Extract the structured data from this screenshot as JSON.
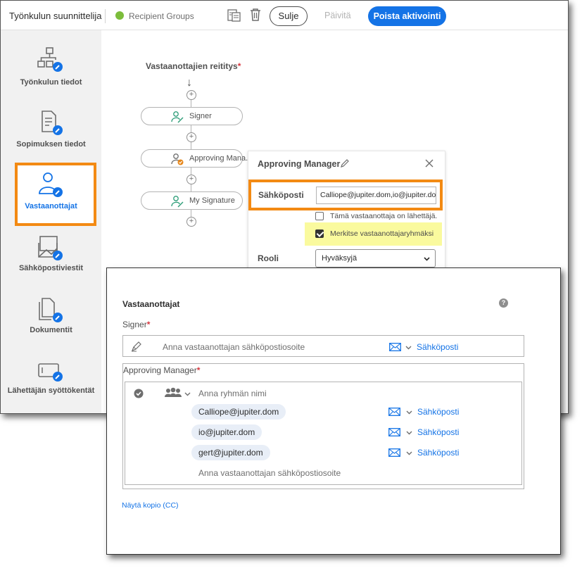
{
  "header": {
    "app_title": "Työnkulun suunnittelija",
    "group_name": "Recipient Groups",
    "status_color": "#7cbd3b",
    "close_label": "Sulje",
    "update_label": "Päivitä",
    "deactivate_label": "Poista aktivointi",
    "accent_color": "#1473e6"
  },
  "sidebar": {
    "items": [
      {
        "label": "Työnkulun tiedot",
        "icon": "workflow-info-icon"
      },
      {
        "label": "Sopimuksen tiedot",
        "icon": "agreement-info-icon"
      },
      {
        "label": "Vastaanottajat",
        "icon": "recipients-icon",
        "active": true
      },
      {
        "label": "Sähköpostiviestit",
        "icon": "email-messages-icon"
      },
      {
        "label": "Dokumentit",
        "icon": "documents-icon"
      },
      {
        "label": "Lähettäjän syöttökentät",
        "icon": "sender-input-fields-icon"
      }
    ],
    "highlight_color": "#f38a13"
  },
  "routing": {
    "title": "Vastaanottajien reititys",
    "required_mark": "*",
    "steps": [
      {
        "label": "Signer",
        "icon": "signer-icon"
      },
      {
        "label": "Approving Mana...",
        "icon": "approver-icon"
      },
      {
        "label": "My Signature",
        "icon": "signer-icon"
      }
    ]
  },
  "panel": {
    "title": "Approving Manager",
    "email_label": "Sähköposti",
    "email_value": "Calliope@jupiter.dom,io@jupiter.dom,gert@jupiter.dom",
    "is_sender_label": "Tämä vastaanottaja on lähettäjä.",
    "is_sender_checked": false,
    "mark_group_label": "Merkitse vastaanottajaryhmäksi",
    "mark_group_checked": true,
    "role_label": "Rooli",
    "role_value": "Hyväksyjä"
  },
  "recipients": {
    "title": "Vastaanottajat",
    "help": "?",
    "signer": {
      "label": "Signer",
      "required_mark": "*",
      "placeholder": "Anna vastaanottajan sähköpostiosoite",
      "method": "Sähköposti"
    },
    "approving_manager": {
      "label": "Approving Manager",
      "required_mark": "*",
      "group_placeholder": "Anna ryhmän nimi",
      "members": [
        {
          "email": "Calliope@jupiter.dom",
          "method": "Sähköposti"
        },
        {
          "email": "io@jupiter.dom",
          "method": "Sähköposti"
        },
        {
          "email": "gert@jupiter.dom",
          "method": "Sähköposti"
        }
      ],
      "add_placeholder": "Anna vastaanottajan sähköpostiosoite"
    },
    "cc_link": "Näytä kopio (CC)"
  }
}
